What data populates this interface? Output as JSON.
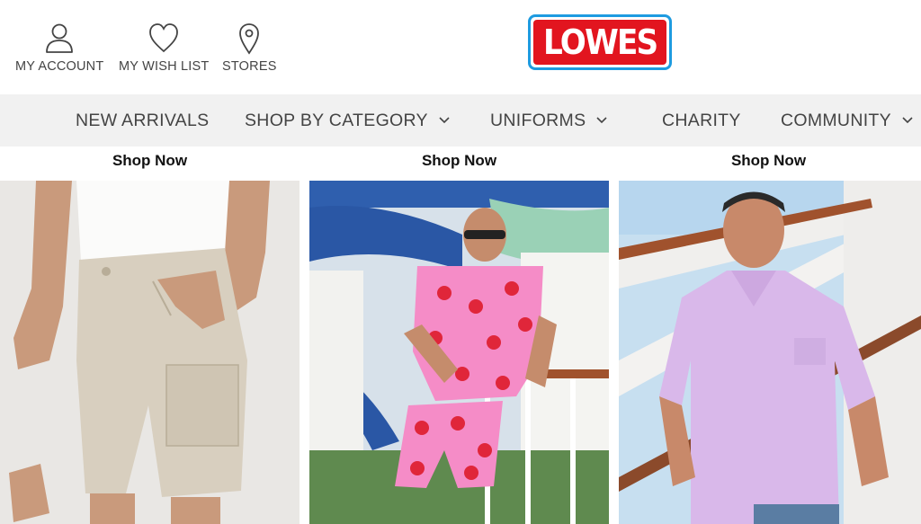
{
  "header": {
    "account_label": "MY ACCOUNT",
    "wishlist_label": "MY WISH LIST",
    "stores_label": "STORES",
    "logo_text": "LOWES"
  },
  "nav": {
    "items": [
      {
        "label": "NEW ARRIVALS",
        "dropdown": false
      },
      {
        "label": "SHOP BY CATEGORY",
        "dropdown": true
      },
      {
        "label": "UNIFORMS",
        "dropdown": true
      },
      {
        "label": "CHARITY",
        "dropdown": false
      },
      {
        "label": "COMMUNITY",
        "dropdown": true
      }
    ]
  },
  "promos": [
    {
      "label": "Shop Now",
      "image": "man-in-beige-cargo-shorts"
    },
    {
      "label": "Shop Now",
      "image": "man-in-strawberry-print-shirt-and-shorts"
    },
    {
      "label": "Shop Now",
      "image": "man-in-lilac-polo-shirt"
    }
  ],
  "colors": {
    "logo_red": "#e2151f",
    "logo_blue": "#1e9be0",
    "nav_bg": "#f1f1f1",
    "text": "#444444"
  }
}
